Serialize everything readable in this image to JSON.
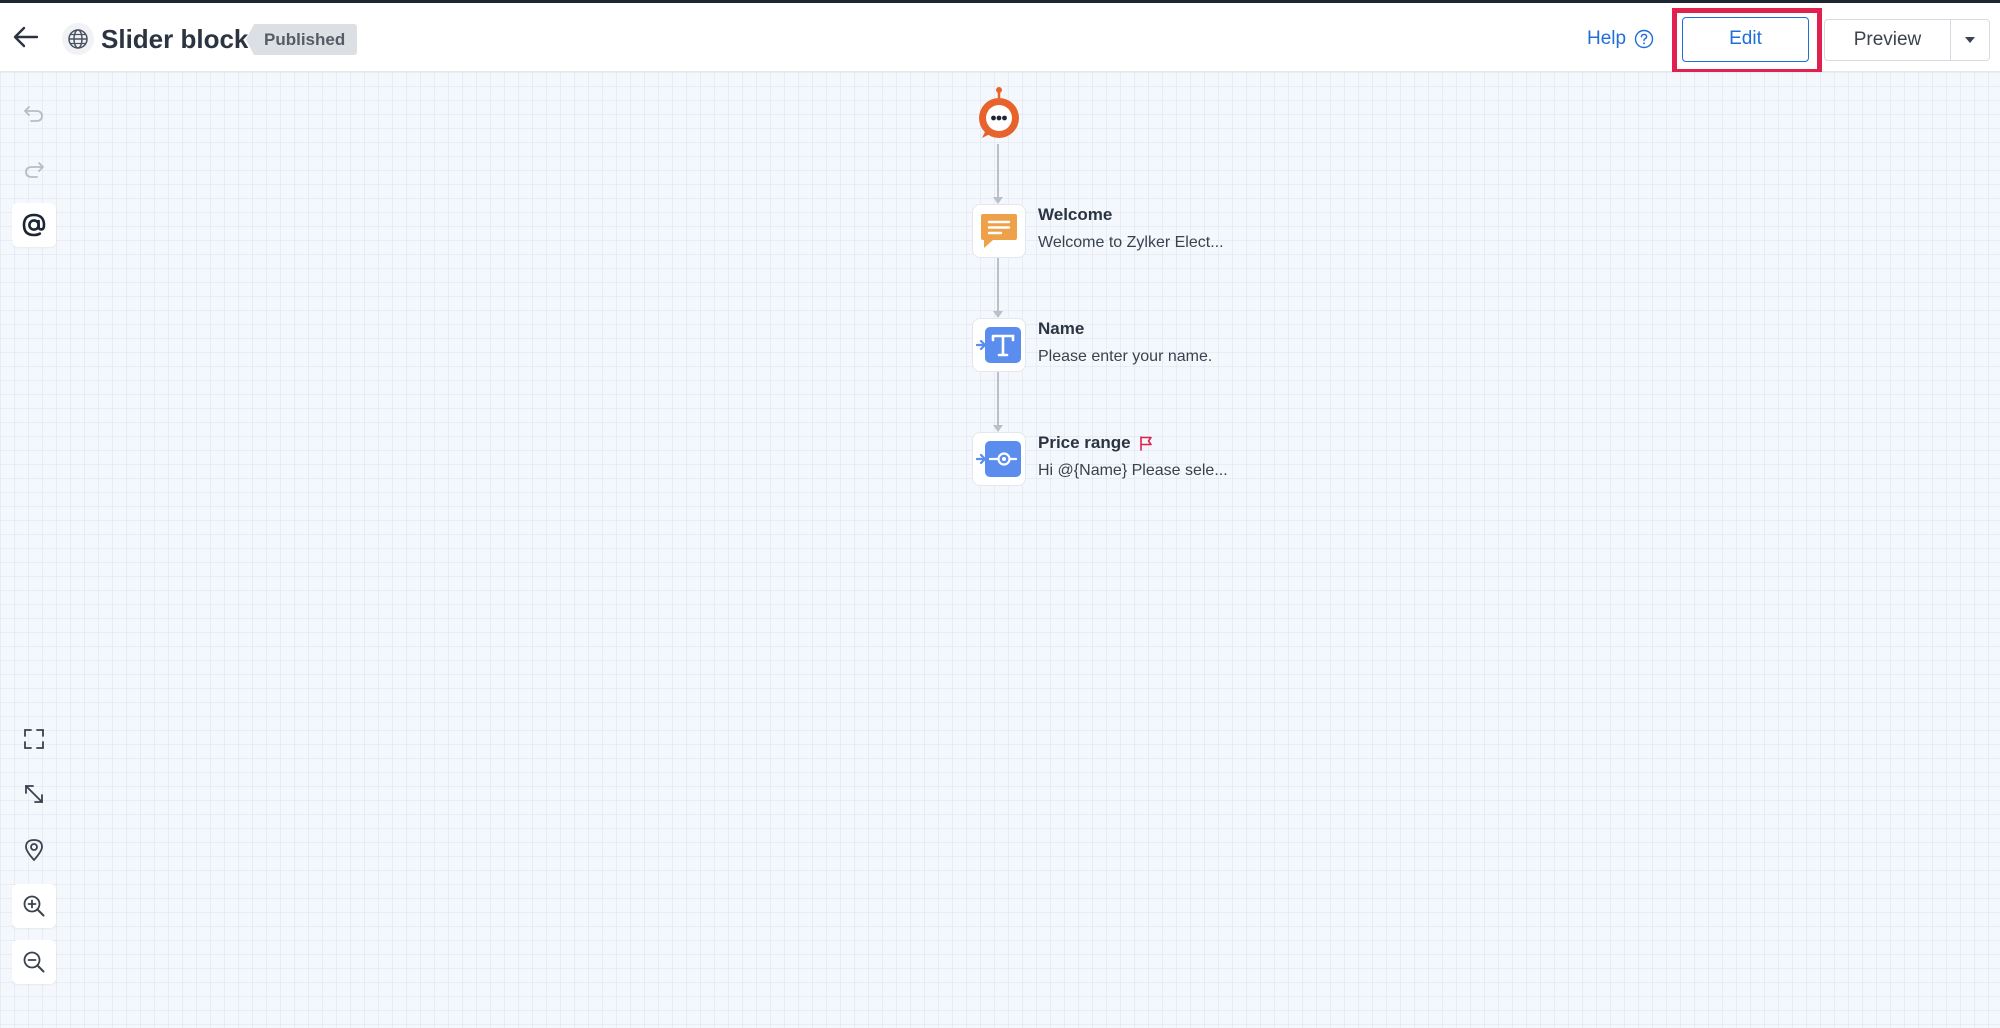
{
  "header": {
    "title": "Slider block",
    "status_badge": "Published",
    "help_label": "Help",
    "edit_label": "Edit",
    "preview_label": "Preview"
  },
  "flow": {
    "nodes": [
      {
        "title": "Welcome",
        "subtitle": "Welcome to Zylker Elect...",
        "icon": "message-icon"
      },
      {
        "title": "Name",
        "subtitle": "Please enter your name.",
        "icon": "text-input-icon"
      },
      {
        "title": "Price range",
        "subtitle": "Hi  @{Name}  Please sele...",
        "icon": "slider-icon"
      }
    ]
  },
  "colors": {
    "accent_blue": "#1f6fd6",
    "highlight_red": "#e0214f",
    "bot_orange": "#e8622c",
    "message_orange": "#efa14a",
    "input_blue": "#5b8def"
  }
}
